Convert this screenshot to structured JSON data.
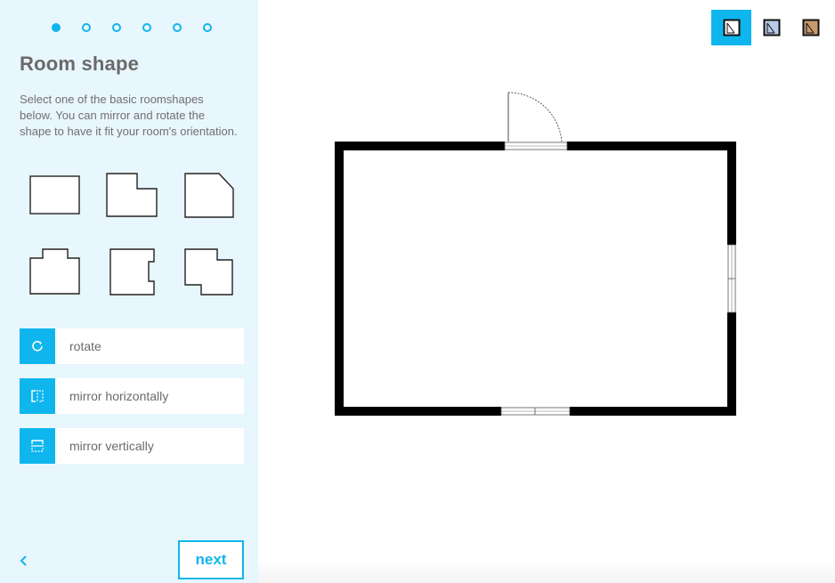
{
  "wizard": {
    "steps": [
      {
        "name": "step-1",
        "active": true
      },
      {
        "name": "step-2",
        "active": false
      },
      {
        "name": "step-3",
        "active": false
      },
      {
        "name": "step-4",
        "active": false
      },
      {
        "name": "step-5",
        "active": false
      },
      {
        "name": "step-6",
        "active": false
      }
    ],
    "title": "Room shape",
    "description": "Select one of the basic roomshapes below. You can mirror and rotate the shape to have it fit your room's orientation.",
    "shapes": [
      "rectangle",
      "l-notch",
      "cut-corner",
      "t-shape",
      "notched-side",
      "offset-l"
    ],
    "actions": {
      "rotate": {
        "label": "rotate",
        "icon": "rotate-icon"
      },
      "mirror_h": {
        "label": "mirror horizontally",
        "icon": "mirror-horizontal-icon"
      },
      "mirror_v": {
        "label": "mirror vertically",
        "icon": "mirror-vertical-icon"
      }
    },
    "back_icon": "chevron-left-icon",
    "next_label": "next"
  },
  "view_modes": [
    {
      "name": "view-2d-plain",
      "active": true
    },
    {
      "name": "view-2d-colored",
      "active": false
    },
    {
      "name": "view-2d-textured",
      "active": false
    }
  ],
  "colors": {
    "accent": "#0fb6ee",
    "sidebar_bg": "#e8f6fd",
    "wall": "#000000"
  }
}
